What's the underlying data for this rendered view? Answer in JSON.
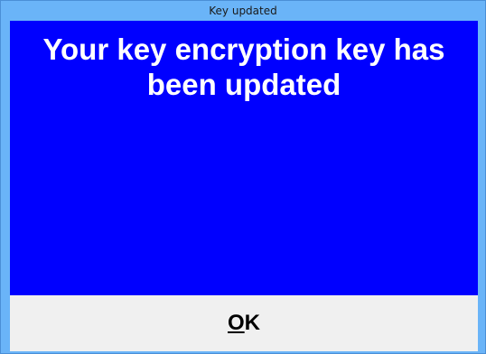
{
  "window": {
    "title": "Key updated"
  },
  "message": {
    "text": "Your key encryption key has been updated"
  },
  "buttons": {
    "ok": {
      "mnemonic": "O",
      "rest": "K"
    }
  },
  "colors": {
    "content_background": "#0000ff",
    "frame": "#6ab4f8",
    "button_area": "#f0f0f0",
    "message_text": "#ffffff"
  }
}
